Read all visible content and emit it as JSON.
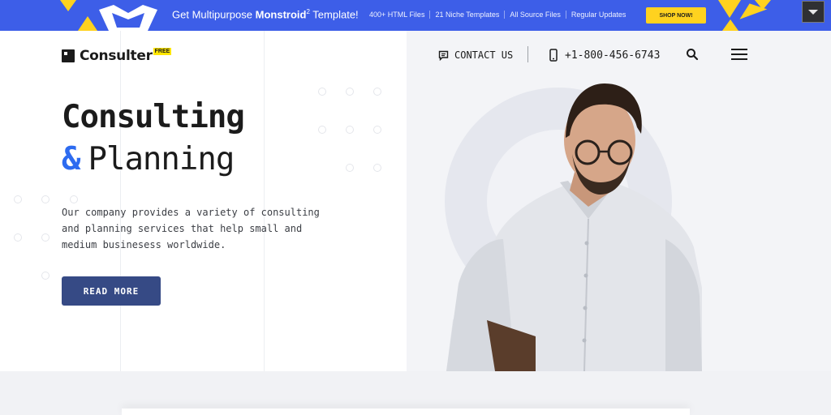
{
  "promo": {
    "title_prefix": "Get Multipurpose",
    "title_brand": "Monstroid",
    "title_sup": "2",
    "title_suffix": "Template!",
    "features": [
      "400+ HTML Files",
      "21 Niche Templates",
      "All Source Files",
      "Regular Updates"
    ],
    "shop_label": "SHOP NOW!",
    "colors": {
      "background": "#3d5ee8",
      "accent": "#ffd21f"
    }
  },
  "header": {
    "logo_text": "Consulter",
    "logo_badge": "FREE",
    "contact_label": "CONTACT US",
    "phone": "+1-800-456-6743"
  },
  "hero": {
    "title_line1": "Consulting",
    "title_amp": "&",
    "title_line2": "Planning",
    "description": "Our company provides a variety of consulting and planning services that help small and medium businesess worldwide.",
    "cta_label": "READ MORE",
    "colors": {
      "accent": "#2d6bf0",
      "button": "#364a85"
    }
  },
  "icons": {
    "chat": "chat-icon",
    "phone": "phone-icon",
    "search": "search-icon",
    "menu": "menu-icon",
    "dropdown": "chevron-down-icon"
  }
}
